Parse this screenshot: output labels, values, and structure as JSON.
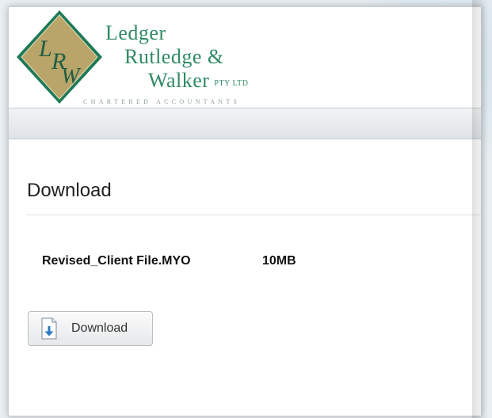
{
  "branding": {
    "line1": "Ledger",
    "line2": "Rutledge &",
    "line3": "Walker",
    "suffix": "PTY LTD",
    "tagline": "CHARTERED ACCOUNTANTS",
    "monogram": "LRW",
    "colors": {
      "diamond_fill": "#b9a469",
      "diamond_border": "#1f7a56",
      "wordmark": "#2f8a63"
    }
  },
  "page": {
    "section_title": "Download",
    "file": {
      "name": "Revised_Client File.MYO",
      "size": "10MB"
    },
    "download_button": {
      "label": "Download",
      "icon": "download-file-icon"
    }
  }
}
